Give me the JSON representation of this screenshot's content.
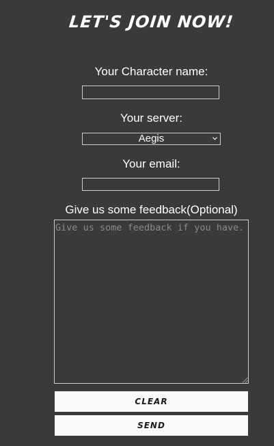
{
  "form": {
    "title": "LET'S JOIN NOW!",
    "character_name_label": "Your Character name:",
    "character_name_value": "",
    "server_label": "Your server:",
    "server_selected": "Aegis",
    "email_label": "Your email:",
    "email_value": "",
    "feedback_label": "Give us some feedback(Optional)",
    "feedback_placeholder": "Give us some feedback if you have.",
    "clear_label": "CLEAR",
    "send_label": "SEND"
  },
  "icons": {
    "select": "chevron-down-icon",
    "textarea": "resize-grip-icon"
  },
  "colors": {
    "background": "#3a3a3a",
    "text": "#ffffff",
    "button_bg": "#fafafa",
    "button_text": "#1a1a1a",
    "border": "#cfcfcf",
    "placeholder": "#8a8a8a"
  }
}
